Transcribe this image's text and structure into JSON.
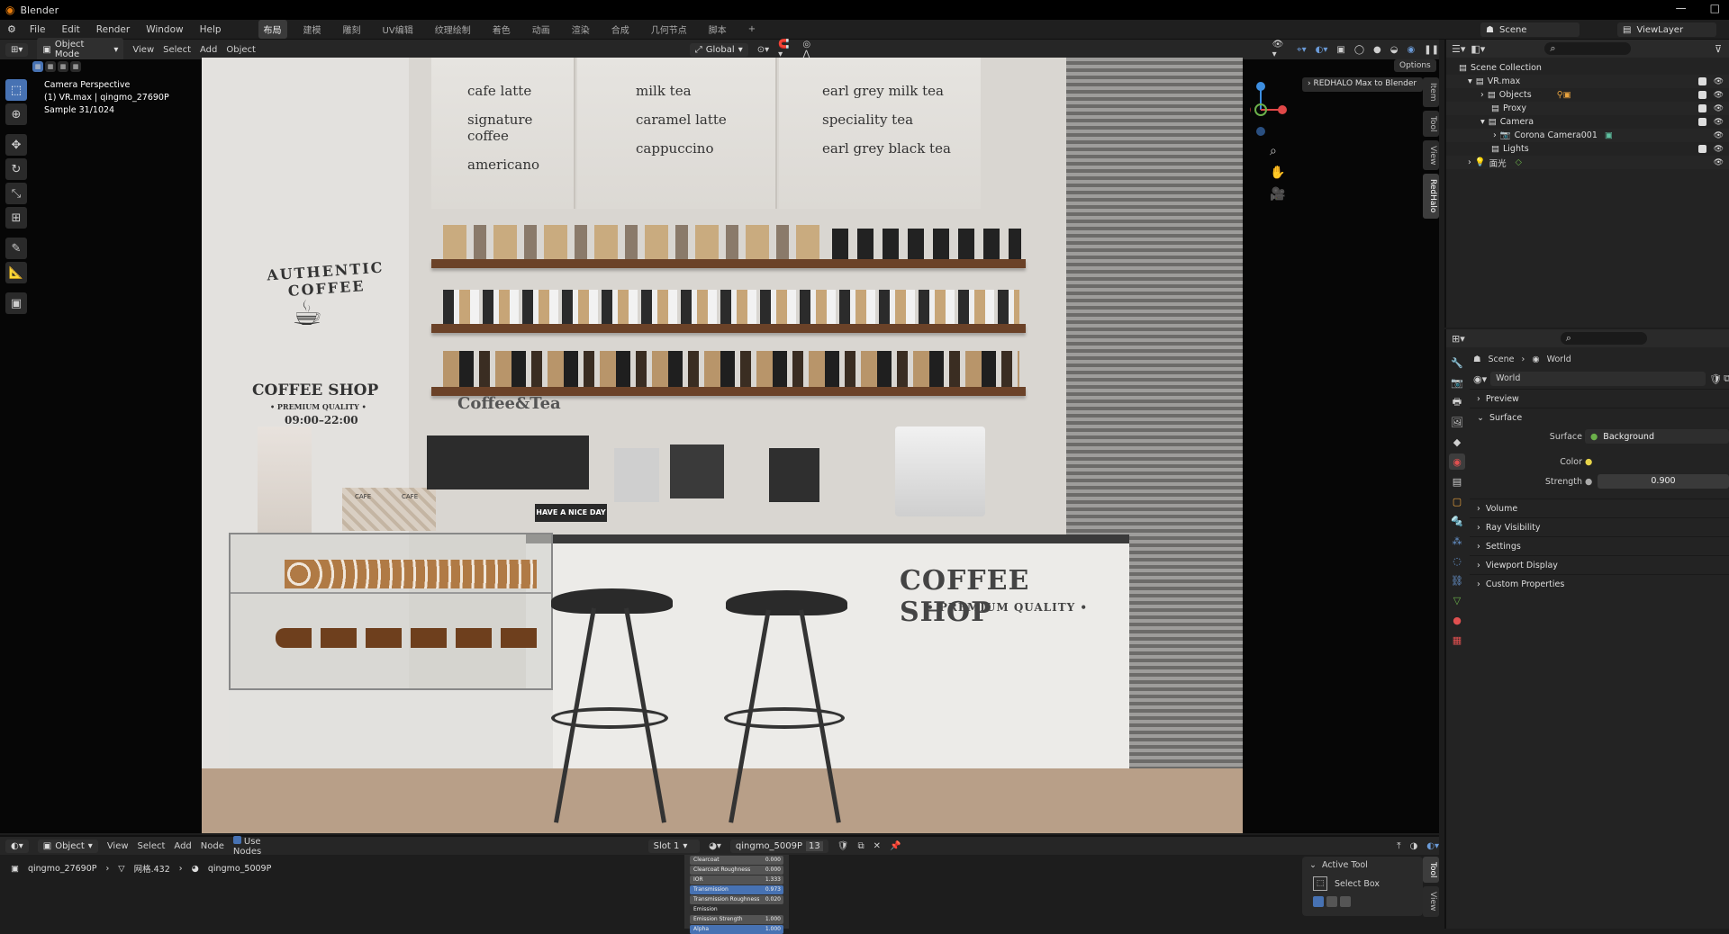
{
  "window": {
    "title": "Blender",
    "minimize": "—",
    "maximize": "□"
  },
  "menu": [
    "File",
    "Edit",
    "Render",
    "Window",
    "Help"
  ],
  "workspaces": [
    "布局",
    "建模",
    "雕刻",
    "UV编辑",
    "纹理绘制",
    "着色",
    "动画",
    "渲染",
    "合成",
    "几何节点",
    "脚本"
  ],
  "workspace_add": "+",
  "scene": {
    "scene_name": "Scene",
    "view_layer": "ViewLayer"
  },
  "viewport_header": {
    "mode": "Object Mode",
    "items": [
      "View",
      "Select",
      "Add",
      "Object"
    ],
    "transform": "Global",
    "options": "Options"
  },
  "viewport_overlay": {
    "line1": "Camera Perspective",
    "line2": "(1) VR.max | qingmo_27690P",
    "line3": "Sample 31/1024"
  },
  "redhalo_panel": "REDHALO Max to Blender",
  "side_tabs": [
    "Item",
    "Tool",
    "View",
    "RedHalo"
  ],
  "render_text": {
    "menu_left": [
      "cafe latte",
      "signature coffee",
      "americano"
    ],
    "menu_mid": [
      "milk tea",
      "caramel latte",
      "cappuccino"
    ],
    "menu_right": [
      "earl grey milk tea",
      "speciality tea",
      "earl grey black tea"
    ],
    "logo_arc": "AUTHENTIC COFFEE",
    "logo_title": "COFFEE SHOP",
    "logo_sub": "• PREMIUM QUALITY •",
    "logo_hours": "09:00–22:00",
    "coffee_tea": "Coffee&Tea",
    "sign": "HAVE A NICE DAY",
    "counter_title": "COFFEE SHOP",
    "counter_sub": "• PREMIUM QUALITY •",
    "box_label": "CAFE"
  },
  "outliner": {
    "root": "Scene Collection",
    "rows": [
      {
        "label": "VR.max",
        "indent": 1
      },
      {
        "label": "Objects",
        "indent": 2
      },
      {
        "label": "Proxy",
        "indent": 2
      },
      {
        "label": "Camera",
        "indent": 2
      },
      {
        "label": "Corona Camera001",
        "indent": 3
      },
      {
        "label": "Lights",
        "indent": 2
      },
      {
        "label": "面光",
        "indent": 1
      }
    ]
  },
  "properties": {
    "breadcrumb": [
      "Scene",
      "World"
    ],
    "datablock": "World",
    "sections": [
      "Preview",
      "Surface",
      "Volume",
      "Ray Visibility",
      "Settings",
      "Viewport Display",
      "Custom Properties"
    ],
    "surface": {
      "surface_label": "Surface",
      "surface_value": "Background",
      "color_label": "Color",
      "strength_label": "Strength",
      "strength_value": "0.900"
    }
  },
  "node_editor": {
    "type": "Object",
    "items": [
      "View",
      "Select",
      "Add",
      "Node"
    ],
    "use_nodes": "Use Nodes",
    "slot": "Slot 1",
    "material": "qingmo_5009P",
    "users": "13",
    "breadcrumb": [
      "qingmo_27690P",
      "网格.432",
      "qingmo_5009P"
    ],
    "node_rows": [
      {
        "label": "Clearcoat",
        "value": "0.000"
      },
      {
        "label": "Clearcoat Roughness",
        "value": "0.000"
      },
      {
        "label": "IOR",
        "value": "1.333"
      },
      {
        "label": "Transmission",
        "value": "0.973"
      },
      {
        "label": "Transmission Roughness",
        "value": "0.020"
      },
      {
        "label": "Emission",
        "value": ""
      },
      {
        "label": "Emission Strength",
        "value": "1.000"
      },
      {
        "label": "Alpha",
        "value": "1.000"
      }
    ]
  },
  "active_tool": {
    "title": "Active Tool",
    "tool": "Select Box"
  },
  "colors": {
    "accent": "#4772b3",
    "blender_orange": "#e87d0d",
    "shelf": "#6b4228"
  }
}
